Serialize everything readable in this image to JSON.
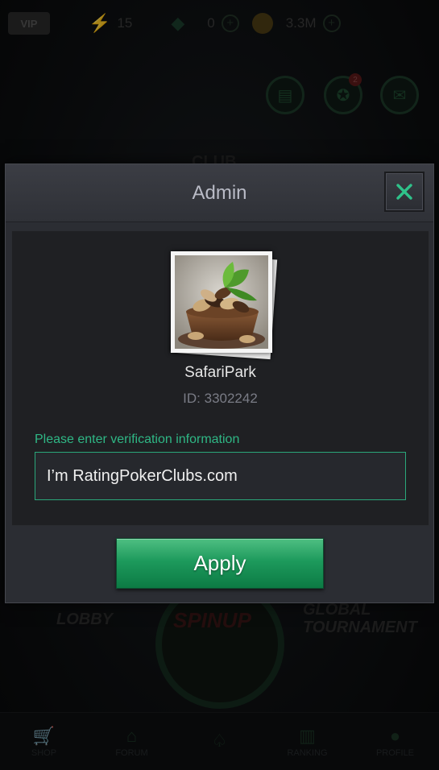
{
  "status_bar": {
    "vip_label": "VIP",
    "energy": "15",
    "gems": "0",
    "coins": "3.3M",
    "mail_badge": "2"
  },
  "background": {
    "club_label": "CLUB",
    "lobby_label": "LOBBY",
    "spinup_label": "SPINUP",
    "global_tournament_label": "GLOBAL TOURNAMENT",
    "nav": [
      "SHOP",
      "FORUM",
      "",
      "RANKING",
      "PROFILE"
    ]
  },
  "modal": {
    "title": "Admin",
    "username": "SafariPark",
    "user_id": "ID: 3302242",
    "verify_label": "Please enter verification information",
    "verify_value": "I’m RatingPokerClubs.com",
    "apply_label": "Apply"
  },
  "colors": {
    "accent_green": "#2fb785",
    "button_green": "#1d9a5c",
    "modal_bg": "#2b2d33"
  }
}
